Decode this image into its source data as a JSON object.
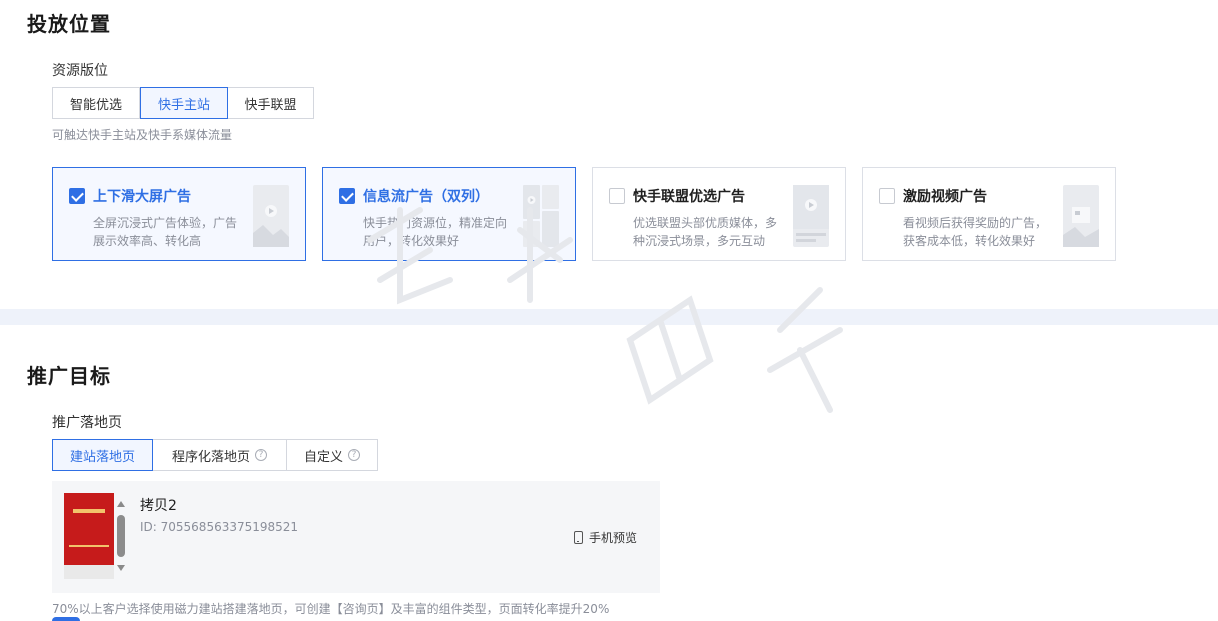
{
  "placement": {
    "title": "投放位置",
    "resource_label": "资源版位",
    "tabs": [
      {
        "label": "智能优选",
        "active": false
      },
      {
        "label": "快手主站",
        "active": true
      },
      {
        "label": "快手联盟",
        "active": false
      }
    ],
    "tabs_hint": "可触达快手主站及快手系媒体流量",
    "cards": [
      {
        "title": "上下滑大屏广告",
        "desc": "全屏沉浸式广告体验，广告展示效率高、转化高",
        "checked": true,
        "icon": "video-portrait-thumb-icon"
      },
      {
        "title": "信息流广告（双列）",
        "desc": "快手热门资源位，精准定向用户，转化效果好",
        "checked": true,
        "icon": "dual-feed-thumb-icon"
      },
      {
        "title": "快手联盟优选广告",
        "desc": "优选联盟头部优质媒体，多种沉浸式场景，多元互动",
        "checked": false,
        "icon": "union-feed-thumb-icon"
      },
      {
        "title": "激励视频广告",
        "desc": "看视频后获得奖励的广告，获客成本低，转化效果好",
        "checked": false,
        "icon": "reward-video-thumb-icon"
      }
    ]
  },
  "target": {
    "title": "推广目标",
    "landing_label": "推广落地页",
    "tabs": [
      {
        "label": "建站落地页",
        "active": true,
        "help": false
      },
      {
        "label": "程序化落地页",
        "active": false,
        "help": true
      },
      {
        "label": "自定义",
        "active": false,
        "help": true
      }
    ],
    "help_glyph": "?",
    "landing_page": {
      "name": "拷贝2",
      "id_text": "ID: 705568563375198521",
      "preview_label": "手机预览"
    },
    "footer_hint": "70%以上客户选择使用磁力建站搭建落地页，可创建【咨询页】及丰富的组件类型，页面转化率提升20%"
  },
  "colors": {
    "accent": "#2f6fe4",
    "band": "#eef2fa",
    "thumb_red": "#c61b1b"
  }
}
